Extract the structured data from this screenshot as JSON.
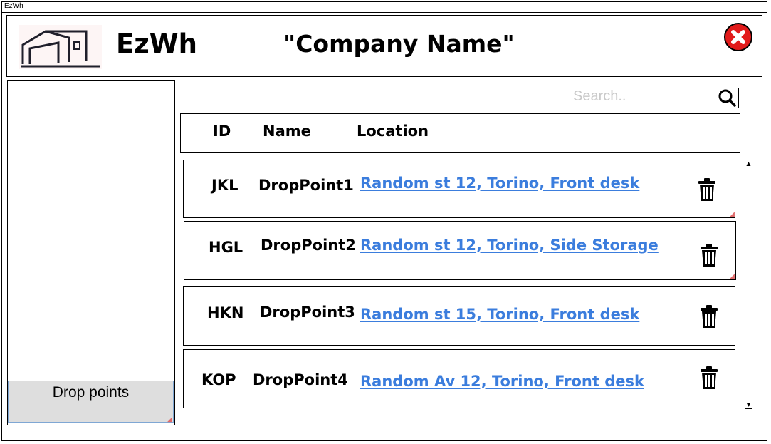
{
  "window": {
    "title": "EzWh"
  },
  "header": {
    "app_name": "EzWh",
    "company": "\"Company Name\""
  },
  "sidebar": {
    "items": [
      {
        "label": "Drop points"
      }
    ]
  },
  "search": {
    "placeholder": "Search.."
  },
  "table": {
    "columns": [
      "ID",
      "Name",
      "Location"
    ],
    "rows": [
      {
        "id": "JKL",
        "name": "DropPoint1",
        "location": "Random st 12, Torino, Front desk"
      },
      {
        "id": "HGL",
        "name": "DropPoint2",
        "location": "Random st 12, Torino, Side Storage"
      },
      {
        "id": "HKN",
        "name": "DropPoint3",
        "location": "Random st 15, Torino, Front desk"
      },
      {
        "id": "KOP",
        "name": "DropPoint4",
        "location": "Random Av 12, Torino, Front desk"
      }
    ]
  },
  "icons": {
    "logo": "warehouse-icon",
    "close": "close-icon",
    "search": "search-icon",
    "delete": "trash-icon"
  },
  "colors": {
    "close": "#e21b1b",
    "link": "#3b7ddd",
    "nav_selected": "#dedede"
  }
}
